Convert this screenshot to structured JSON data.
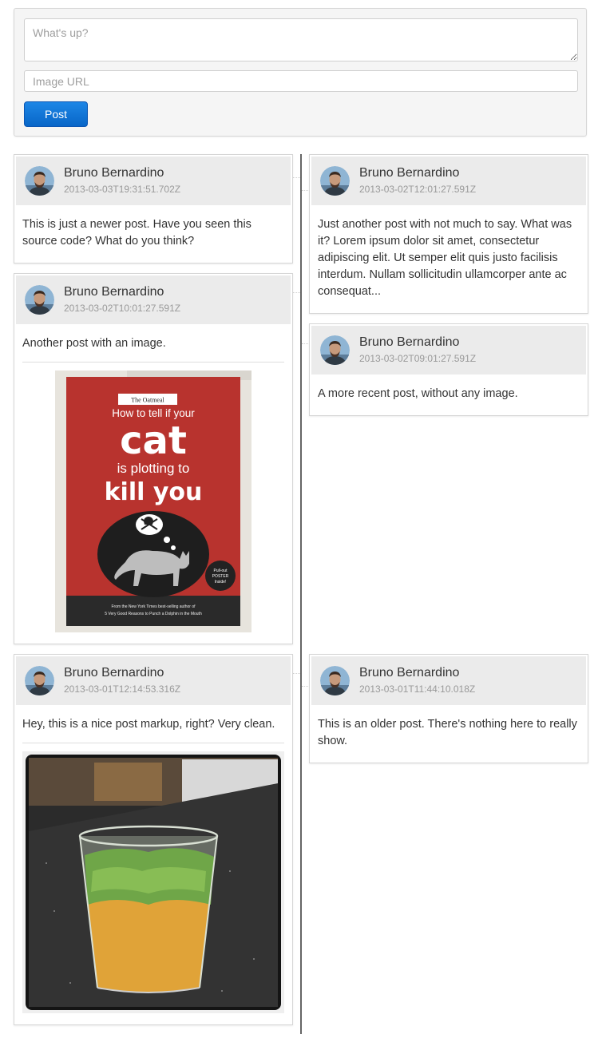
{
  "composer": {
    "status_placeholder": "What's up?",
    "image_url_placeholder": "Image URL",
    "post_label": "Post"
  },
  "posts": [
    {
      "author": "Bruno Bernardino",
      "date": "2013-03-03T19:31:51.702Z",
      "text": "This is just a newer post. Have you seen this source code? What do you think?"
    },
    {
      "author": "Bruno Bernardino",
      "date": "2013-03-02T12:01:27.591Z",
      "text": "Just another post with not much to say. What was it? Lorem ipsum dolor sit amet, consectetur adipiscing elit. Ut semper elit quis justo facilisis interdum. Nullam sollicitudin ullamcorper ante ac consequat..."
    },
    {
      "author": "Bruno Bernardino",
      "date": "2013-03-02T10:01:27.591Z",
      "text": "Another post with an image."
    },
    {
      "author": "Bruno Bernardino",
      "date": "2013-03-02T09:01:27.591Z",
      "text": "A more recent post, without any image."
    },
    {
      "author": "Bruno Bernardino",
      "date": "2013-03-01T12:14:53.316Z",
      "text": "Hey, this is a nice post markup, right? Very clean."
    },
    {
      "author": "Bruno Bernardino",
      "date": "2013-03-01T11:44:10.018Z",
      "text": "This is an older post. There's nothing here to really show."
    }
  ],
  "book": {
    "brand": "The Oatmeal",
    "line1": "How to tell if your",
    "line2": "cat",
    "line3": "is plotting to",
    "line4": "kill you",
    "badge": "Pull-out POSTER Inside!",
    "footer1": "From the New York Times best-selling author of",
    "footer2": "5 Very Good Reasons to Punch a Dolphin in the Mouth"
  },
  "colors": {
    "accent": "#0866c8",
    "timeline": "#666666",
    "header_bg": "#ebebeb",
    "book_red": "#b8332e"
  }
}
